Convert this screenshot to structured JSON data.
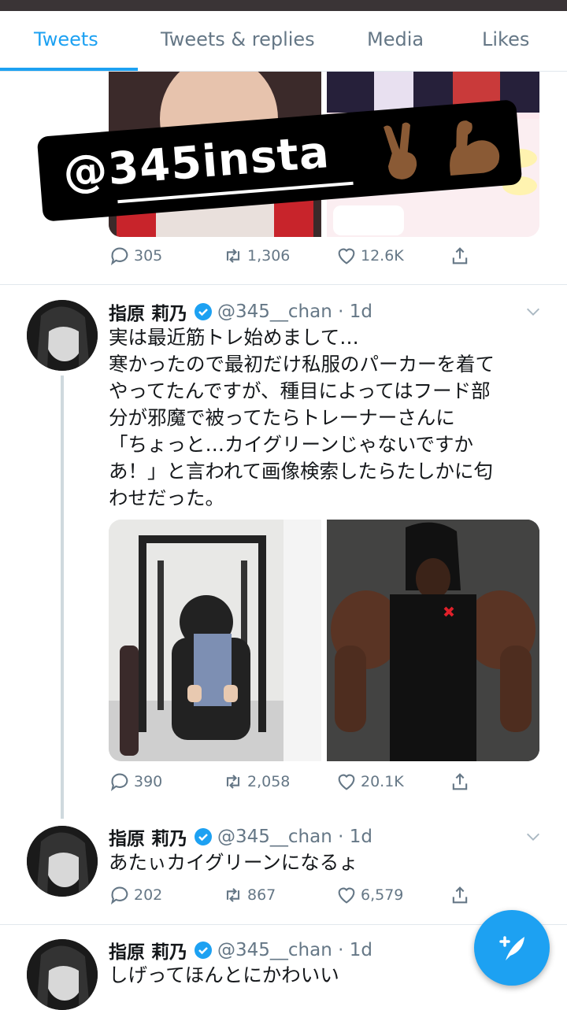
{
  "tabs": [
    {
      "label": "Tweets",
      "active": true
    },
    {
      "label": "Tweets & replies",
      "active": false
    },
    {
      "label": "Media",
      "active": false
    },
    {
      "label": "Likes",
      "active": false
    }
  ],
  "sticker": {
    "text": "@345insta"
  },
  "tweet0": {
    "replies": "305",
    "retweets": "1,306",
    "likes": "12.6K"
  },
  "tweet1": {
    "name": "指原 莉乃",
    "handle": "@345__chan · 1d",
    "lines": [
      "実は最近筋トレ始めまして…",
      "寒かったので最初だけ私服のパーカーを着て",
      "やってたんですが、種目によってはフード部",
      "分が邪魔で被ってたらトレーナーさんに",
      "「ちょっと…カイグリーンじゃないですか",
      "あ！」と言われて画像検索したらたしかに匂",
      "わせだった。"
    ],
    "replies": "390",
    "retweets": "2,058",
    "likes": "20.1K"
  },
  "tweet2": {
    "name": "指原 莉乃",
    "handle": "@345__chan · 1d",
    "text": "あたぃカイグリーンになるょ",
    "replies": "202",
    "retweets": "867",
    "likes": "6,579"
  },
  "tweet3": {
    "name": "指原 莉乃",
    "handle": "@345__chan · 1d",
    "text": "しげってほんとにかわいい"
  },
  "colors": {
    "accent": "#1da1f2",
    "muted": "#657786",
    "divider": "#e1e8ed"
  }
}
